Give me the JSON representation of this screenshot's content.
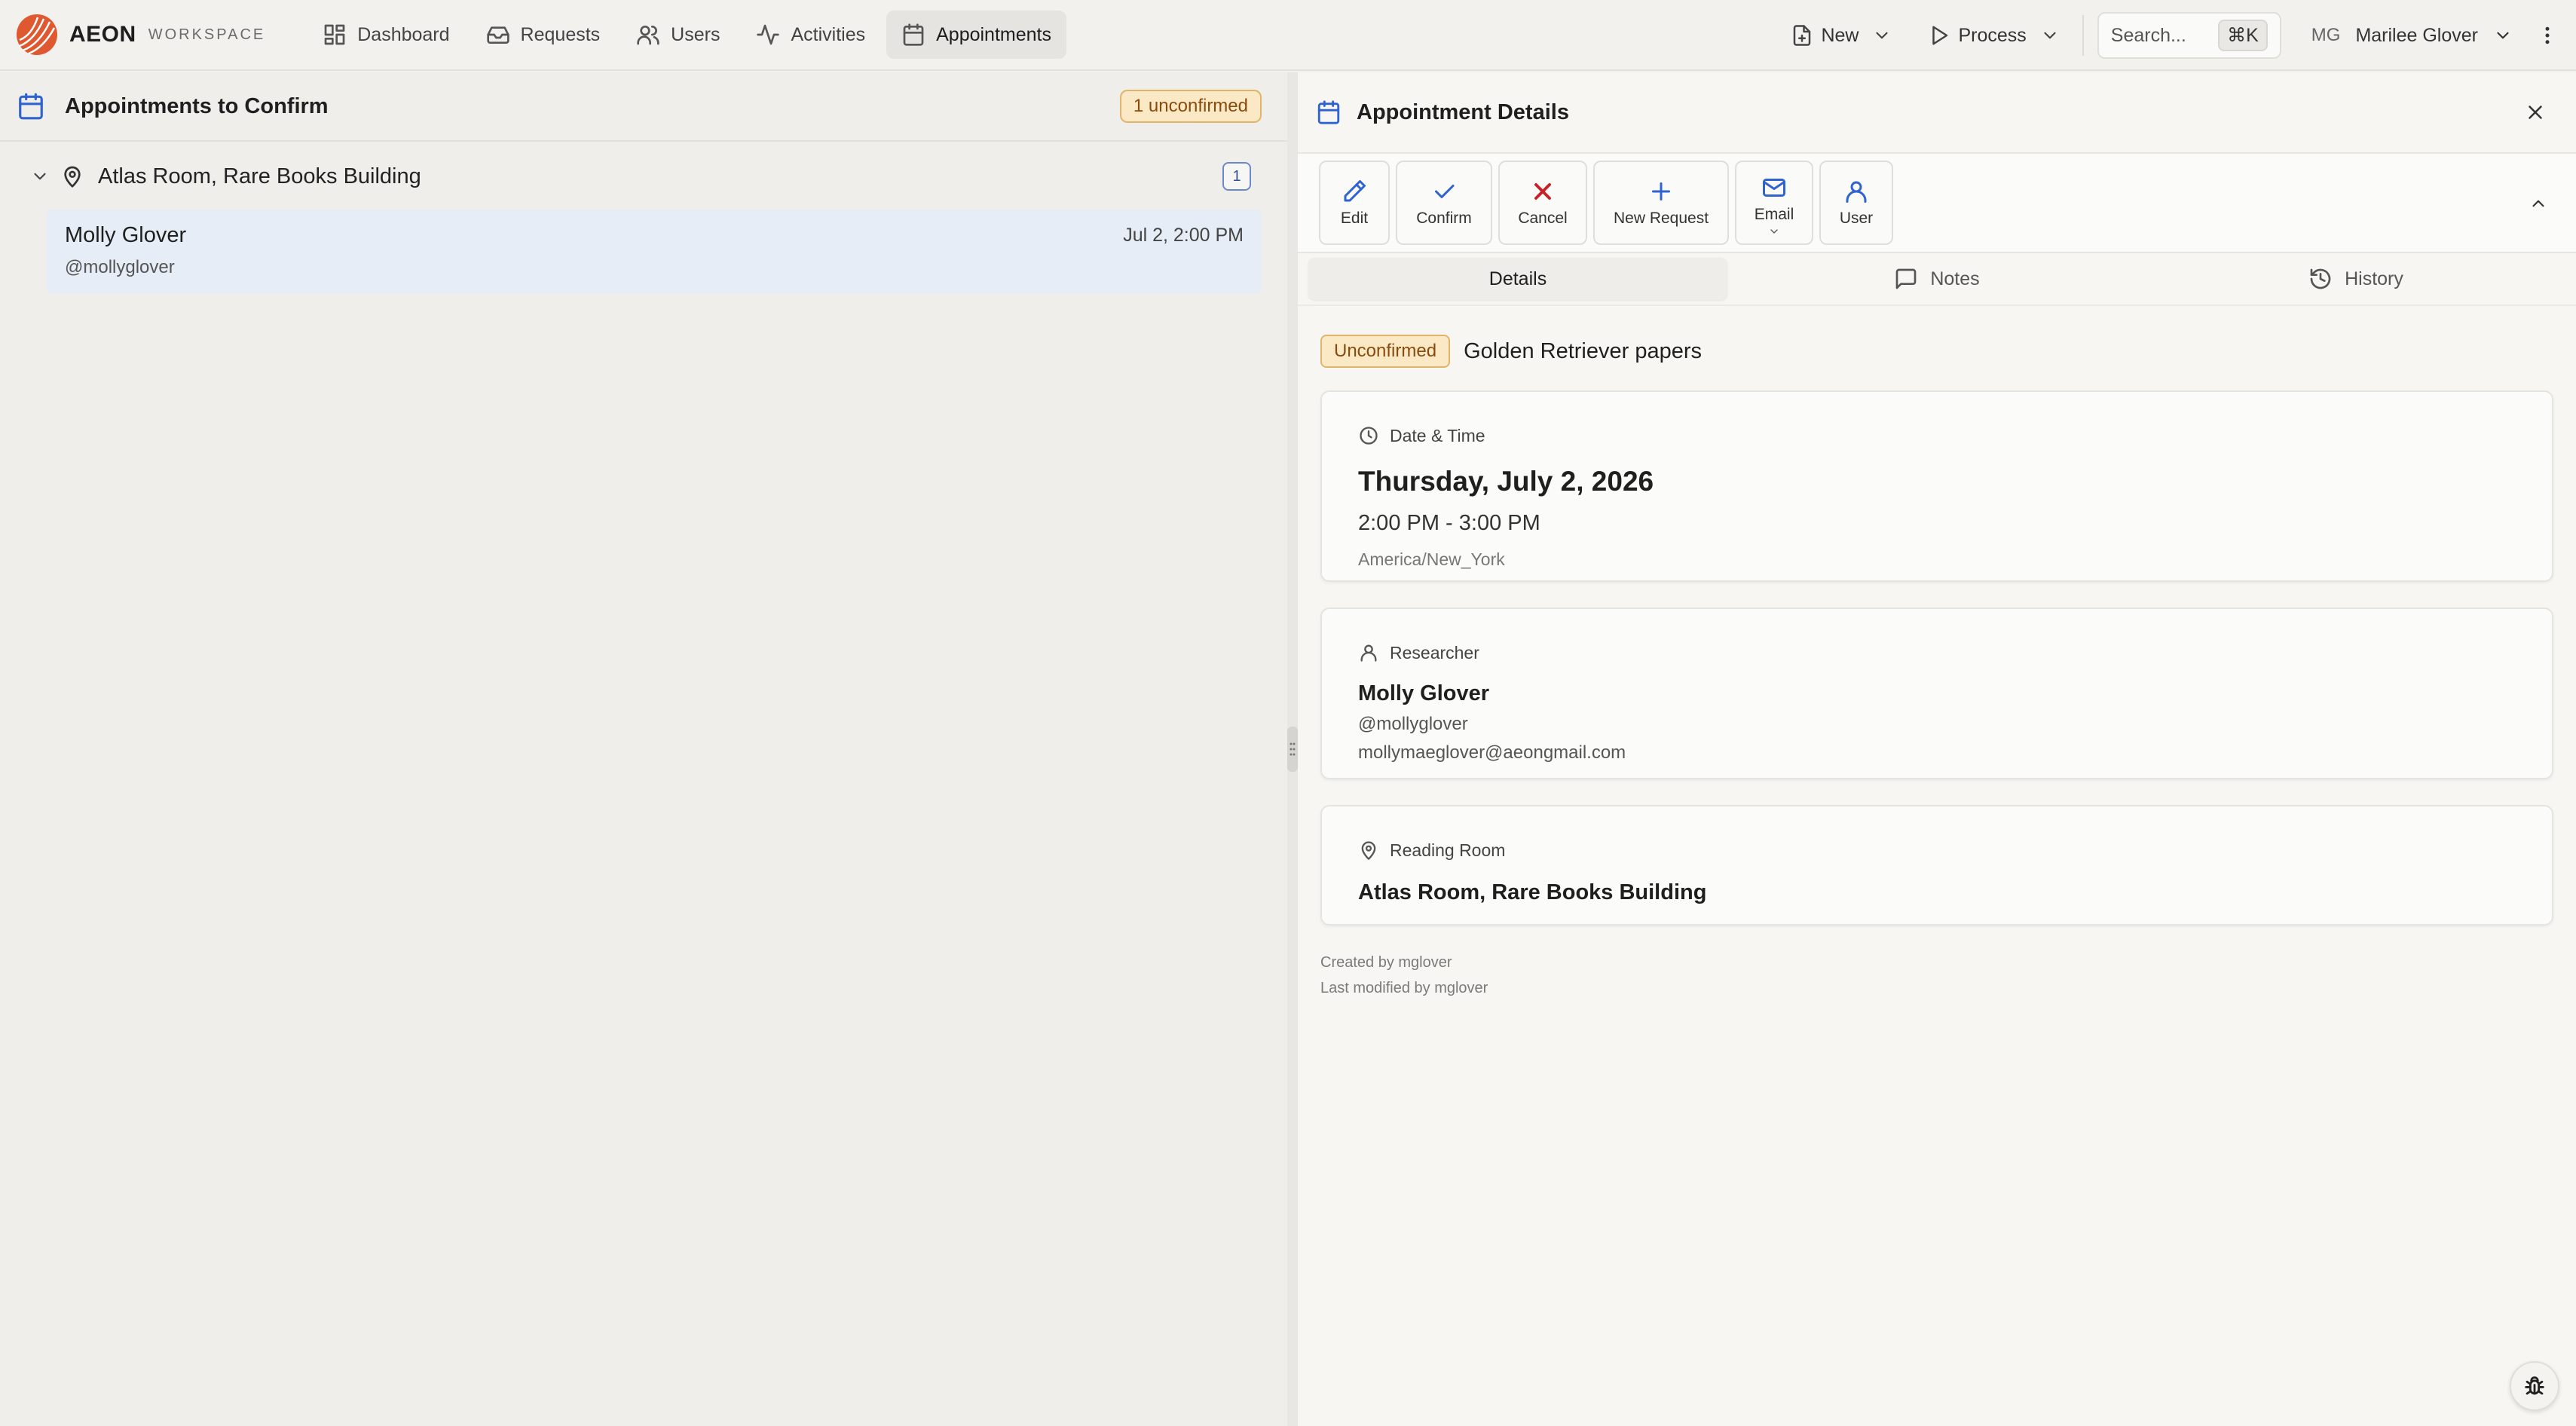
{
  "brand": {
    "name": "AEON",
    "sub": "WORKSPACE"
  },
  "nav": {
    "items": [
      {
        "label": "Dashboard",
        "icon": "dashboard-icon"
      },
      {
        "label": "Requests",
        "icon": "inbox-icon"
      },
      {
        "label": "Users",
        "icon": "users-icon"
      },
      {
        "label": "Activities",
        "icon": "activity-icon"
      },
      {
        "label": "Appointments",
        "icon": "calendar-icon",
        "active": true
      }
    ],
    "new_label": "New",
    "process_label": "Process",
    "search_label": "Search...",
    "search_shortcut": "⌘K",
    "user_initials": "MG",
    "user_name": "Marilee Glover"
  },
  "left": {
    "title": "Appointments to Confirm",
    "badge": "1 unconfirmed",
    "group": {
      "name": "Atlas Room, Rare Books Building",
      "count": "1"
    },
    "item": {
      "name": "Molly Glover",
      "handle": "@mollyglover",
      "date": "Jul 2, 2:00 PM"
    }
  },
  "right": {
    "title": "Appointment Details",
    "toolbar": {
      "edit": "Edit",
      "confirm": "Confirm",
      "cancel": "Cancel",
      "new_request": "New Request",
      "email": "Email",
      "user": "User"
    },
    "tabs": {
      "details": "Details",
      "notes": "Notes",
      "history": "History"
    },
    "status": "Unconfirmed",
    "appointment_title": "Golden Retriever papers",
    "datetime": {
      "label": "Date & Time",
      "date": "Thursday, July 2, 2026",
      "time": "2:00 PM - 3:00 PM",
      "timezone": "America/New_York"
    },
    "researcher": {
      "label": "Researcher",
      "name": "Molly Glover",
      "handle": "@mollyglover",
      "email": "mollymaeglover@aeongmail.com"
    },
    "room": {
      "label": "Reading Room",
      "name": "Atlas Room, Rare Books Building"
    },
    "meta": {
      "created": "Created by mglover",
      "modified": "Last modified by mglover"
    }
  },
  "colors": {
    "accent_blue": "#2f63d0",
    "danger_red": "#c7212a",
    "warning_bg": "#fbe9c6",
    "warning_text": "#8a4a0b",
    "selected_row": "#e6edf6"
  }
}
